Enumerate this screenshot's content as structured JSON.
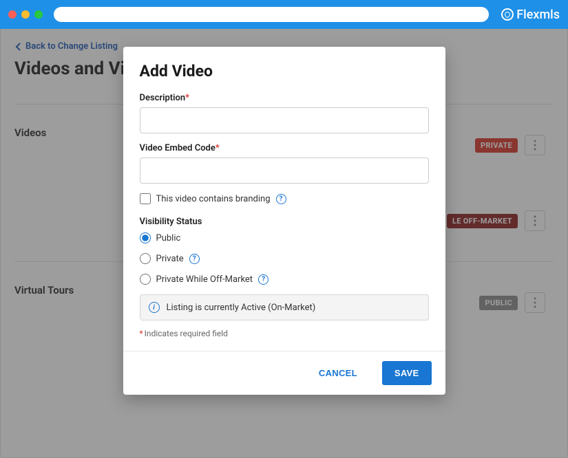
{
  "brand": "Flexmls",
  "backLink": "Back to Change Listing",
  "pageTitle": "Videos and Virtual Tours",
  "sections": {
    "videos": {
      "label": "Videos",
      "items": [
        {
          "badge": "PRIVATE",
          "badgeClass": "private"
        },
        {
          "badge": "LE OFF-MARKET",
          "badgeClass": "offmkt"
        }
      ]
    },
    "tours": {
      "label": "Virtual Tours",
      "items": [
        {
          "badge": "PUBLIC",
          "badgeClass": "public"
        }
      ]
    }
  },
  "modal": {
    "title": "Add Video",
    "fields": {
      "descLabel": "Description",
      "embedLabel": "Video Embed Code",
      "brandingLabel": "This video contains branding",
      "visibilityLabel": "Visibility Status",
      "options": {
        "public": "Public",
        "private": "Private",
        "offmkt": "Private While Off-Market"
      }
    },
    "info": "Listing is currently Active (On-Market)",
    "reqNote": "Indicates required field",
    "buttons": {
      "cancel": "CANCEL",
      "save": "SAVE"
    }
  }
}
